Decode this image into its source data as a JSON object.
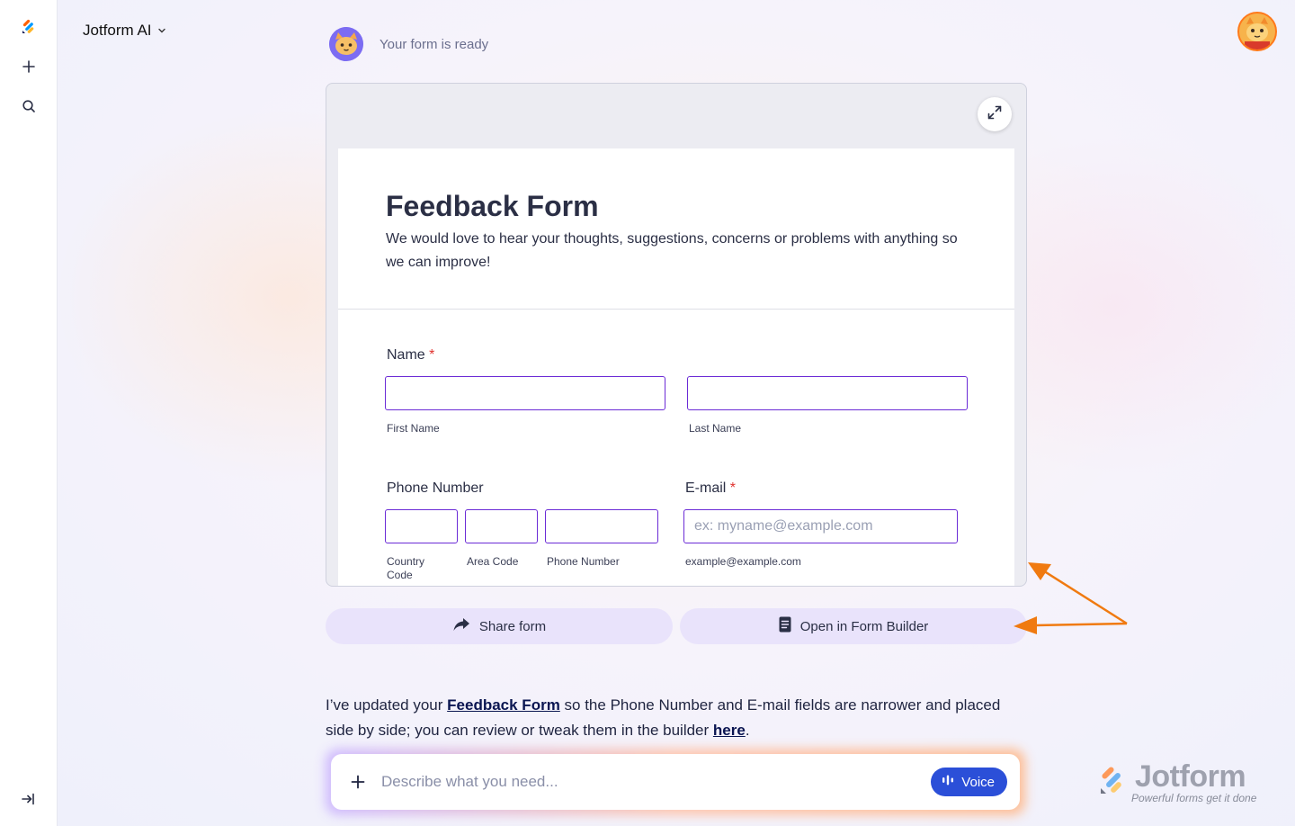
{
  "app": {
    "name": "Jotform AI"
  },
  "chat": {
    "status": "Your form is ready"
  },
  "form": {
    "title": "Feedback Form",
    "description": "We would love to hear your thoughts, suggestions, concerns or problems with anything so we can improve!",
    "name_label": "Name",
    "name_required": "*",
    "first_name_sub": "First Name",
    "last_name_sub": "Last Name",
    "phone_label": "Phone Number",
    "country_code_sub": "Country Code",
    "area_code_sub": "Area Code",
    "phone_number_sub": "Phone Number",
    "email_label": "E-mail",
    "email_required": "*",
    "email_placeholder": "ex: myname@example.com",
    "email_sub": "example@example.com"
  },
  "actions": {
    "share_label": "Share form",
    "open_builder_label": "Open in Form Builder"
  },
  "message": {
    "part1": "I’ve updated your ",
    "link1": "Feedback Form",
    "part2": " so the Phone Number and E-mail fields are narrower and placed side by side; you can review or tweak them in the builder ",
    "link2": "here",
    "part3": "."
  },
  "composer": {
    "placeholder": "Describe what you need...",
    "voice_label": "Voice"
  },
  "watermark": {
    "brand": "Jotform",
    "tagline": "Powerful forms get it done"
  },
  "colors": {
    "accent": "#2b4fd8",
    "field_border": "#6b2bd6",
    "required": "#e0322e",
    "annotation_arrow": "#f07a10",
    "action_bg": "#e9e3fb"
  },
  "icons": {
    "logo": "jotform-logo-icon",
    "new": "plus-icon",
    "search": "search-icon",
    "collapse": "sidebar-expand-icon",
    "dropdown": "chevron-down-icon",
    "expand": "expand-icon",
    "share": "share-arrow-icon",
    "builder": "document-icon",
    "voice": "audio-wave-icon"
  }
}
